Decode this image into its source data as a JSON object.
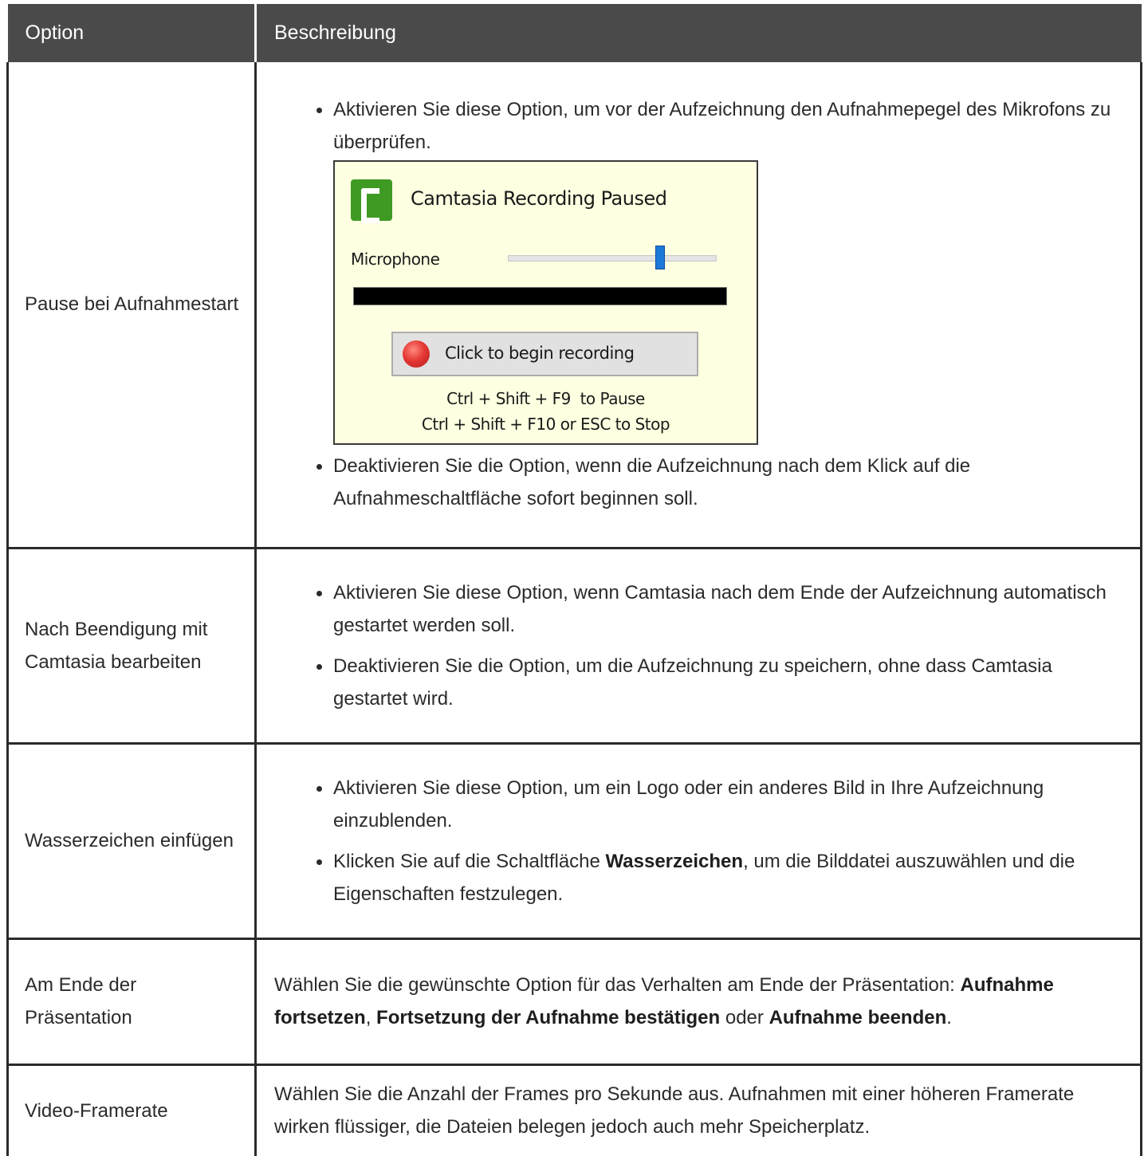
{
  "header": {
    "option": "Option",
    "description": "Beschreibung"
  },
  "rows": [
    {
      "option": "Pause bei Aufnahmestart",
      "bullet1": "Aktivieren Sie diese Option, um vor der Aufzeichnung den Aufnahmepegel des Mikrofons zu überprüfen.",
      "bullet2": "Deaktivieren Sie die Option, wenn die Aufzeichnung nach dem Klick auf die Aufnahmeschaltfläche sofort beginnen soll."
    },
    {
      "option": "Nach Beendigung mit Camtasia bearbeiten",
      "bullet1": "Aktivieren Sie diese Option, wenn Camtasia nach dem Ende der Aufzeichnung automatisch gestartet werden soll.",
      "bullet2": "Deaktivieren Sie die Option, um die Aufzeichnung zu speichern, ohne dass Camtasia gestartet wird."
    },
    {
      "option": "Wasserzeichen einfügen",
      "bullet1": "Aktivieren Sie diese Option, um ein Logo oder ein anderes Bild in Ihre Aufzeichnung einzublenden.",
      "bullet2_pre": "Klicken Sie auf die Schaltfläche ",
      "bullet2_bold": "Wasserzeichen",
      "bullet2_post": ", um die Bilddatei auszuwählen und die Eigenschaften festzulegen."
    },
    {
      "option": "Am Ende der Präsentation",
      "text_pre": "Wählen Sie die gewünschte Option für das Verhalten am Ende der Präsentation: ",
      "bold1": "Aufnahme fortsetzen",
      "sep1": ", ",
      "bold2": "Fortsetzung der Aufnahme bestätigen",
      "sep2": " oder ",
      "bold3": "Aufnahme beenden",
      "end": "."
    },
    {
      "option": "Video-Framerate",
      "text": "Wählen Sie die Anzahl der Frames pro Sekunde aus. Aufnahmen mit einer höheren Framerate wirken flüssiger, die Dateien belegen jedoch auch mehr Speicherplatz."
    }
  ],
  "dialog": {
    "title": "Camtasia Recording Paused",
    "mic_label": "Microphone",
    "mic_level_fraction": 0.73,
    "button_label": "Click to begin recording",
    "hint_pause": "Ctrl + Shift + F9  to Pause",
    "hint_stop": "Ctrl + Shift + F10 or ESC to Stop"
  }
}
